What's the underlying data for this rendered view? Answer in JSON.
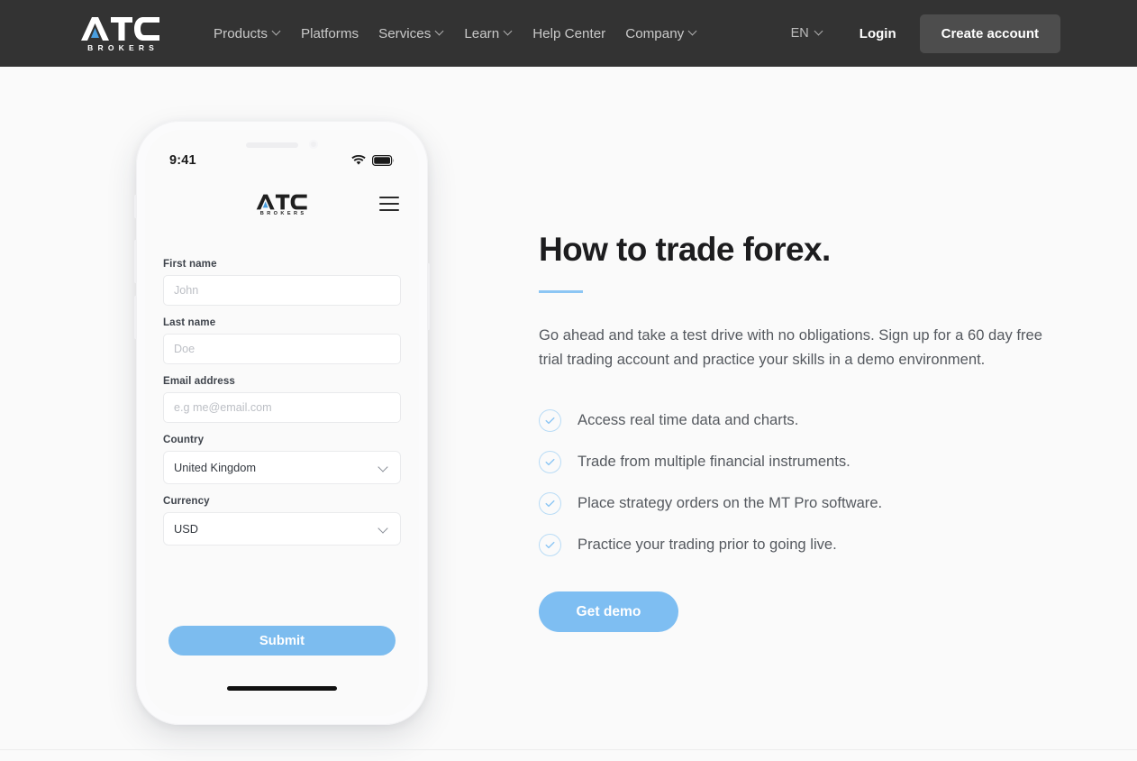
{
  "colors": {
    "nav_bg": "#333333",
    "page_bg": "#fafafa",
    "accent_blue": "#7ebef2",
    "accent_blue_light": "#8cc6f4",
    "check_ring": "#b9dcf6",
    "create_btn_bg": "#4d4d4d",
    "heading": "#1d1d1f",
    "body_text": "#55595f"
  },
  "header": {
    "logo": {
      "main": "ATC",
      "sub": "BROKERS"
    },
    "nav_items": [
      {
        "label": "Products",
        "has_chevron": true
      },
      {
        "label": "Platforms",
        "has_chevron": false
      },
      {
        "label": "Services",
        "has_chevron": true
      },
      {
        "label": "Learn",
        "has_chevron": true
      },
      {
        "label": "Help Center",
        "has_chevron": false
      },
      {
        "label": "Company",
        "has_chevron": true
      }
    ],
    "language": "EN",
    "login_label": "Login",
    "create_account_label": "Create account"
  },
  "phone": {
    "status": {
      "time": "9:41",
      "wifi_icon": "wifi-icon",
      "battery_icon": "battery-icon"
    },
    "logo": {
      "main": "ATC",
      "sub": "BROKERS"
    },
    "menu_icon": "hamburger-menu-icon",
    "form": {
      "fields": [
        {
          "label": "First name",
          "placeholder": "John",
          "value": "",
          "type": "text"
        },
        {
          "label": "Last name",
          "placeholder": "Doe",
          "value": "",
          "type": "text"
        },
        {
          "label": "Email address",
          "placeholder": "e.g me@email.com",
          "value": "",
          "type": "text"
        },
        {
          "label": "Country",
          "placeholder": "",
          "value": "United Kingdom",
          "type": "select"
        },
        {
          "label": "Currency",
          "placeholder": "",
          "value": "USD",
          "type": "select"
        }
      ],
      "submit_label": "Submit"
    }
  },
  "main": {
    "headline": "How to trade forex.",
    "lede": "Go ahead and take a test drive with no obligations. Sign up for a 60 day free trial trading account and practice your skills in a demo environment.",
    "checklist": [
      "Access real time data and charts.",
      "Trade from multiple financial instruments.",
      "Place strategy orders on the MT Pro software.",
      "Practice your trading prior to going live."
    ],
    "cta_label": "Get demo"
  }
}
